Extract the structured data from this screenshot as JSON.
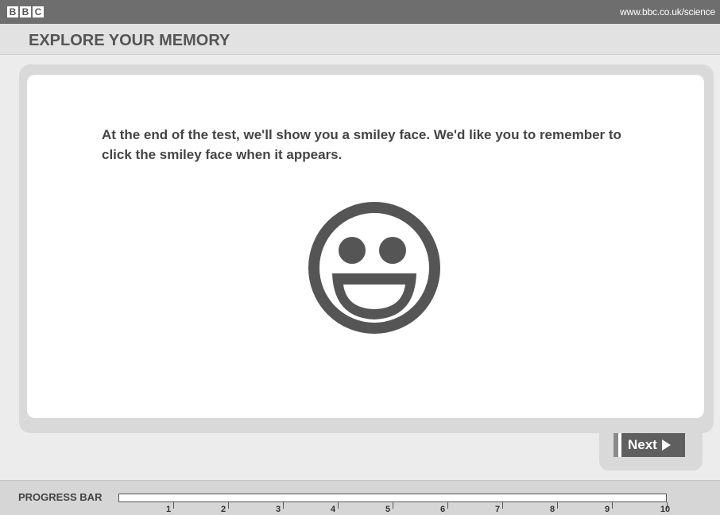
{
  "header": {
    "logo": [
      "B",
      "B",
      "C"
    ],
    "url": "www.bbc.co.uk/science",
    "title": "EXPLORE YOUR MEMORY"
  },
  "content": {
    "instruction": "At the end of the test, we'll show you a smiley face. We'd like you to remember to click the smiley face when it appears.",
    "image": "smiley-face-icon"
  },
  "navigation": {
    "next_label": "Next",
    "next_icon": "play-arrow-icon"
  },
  "progress": {
    "label": "PROGRESS BAR",
    "steps": [
      "1",
      "2",
      "3",
      "4",
      "5",
      "6",
      "7",
      "8",
      "9",
      "10"
    ],
    "completed_fraction": 0
  },
  "colors": {
    "accent": "#555555",
    "button": "#5f5f5f",
    "panel": "#d9d9d9"
  }
}
